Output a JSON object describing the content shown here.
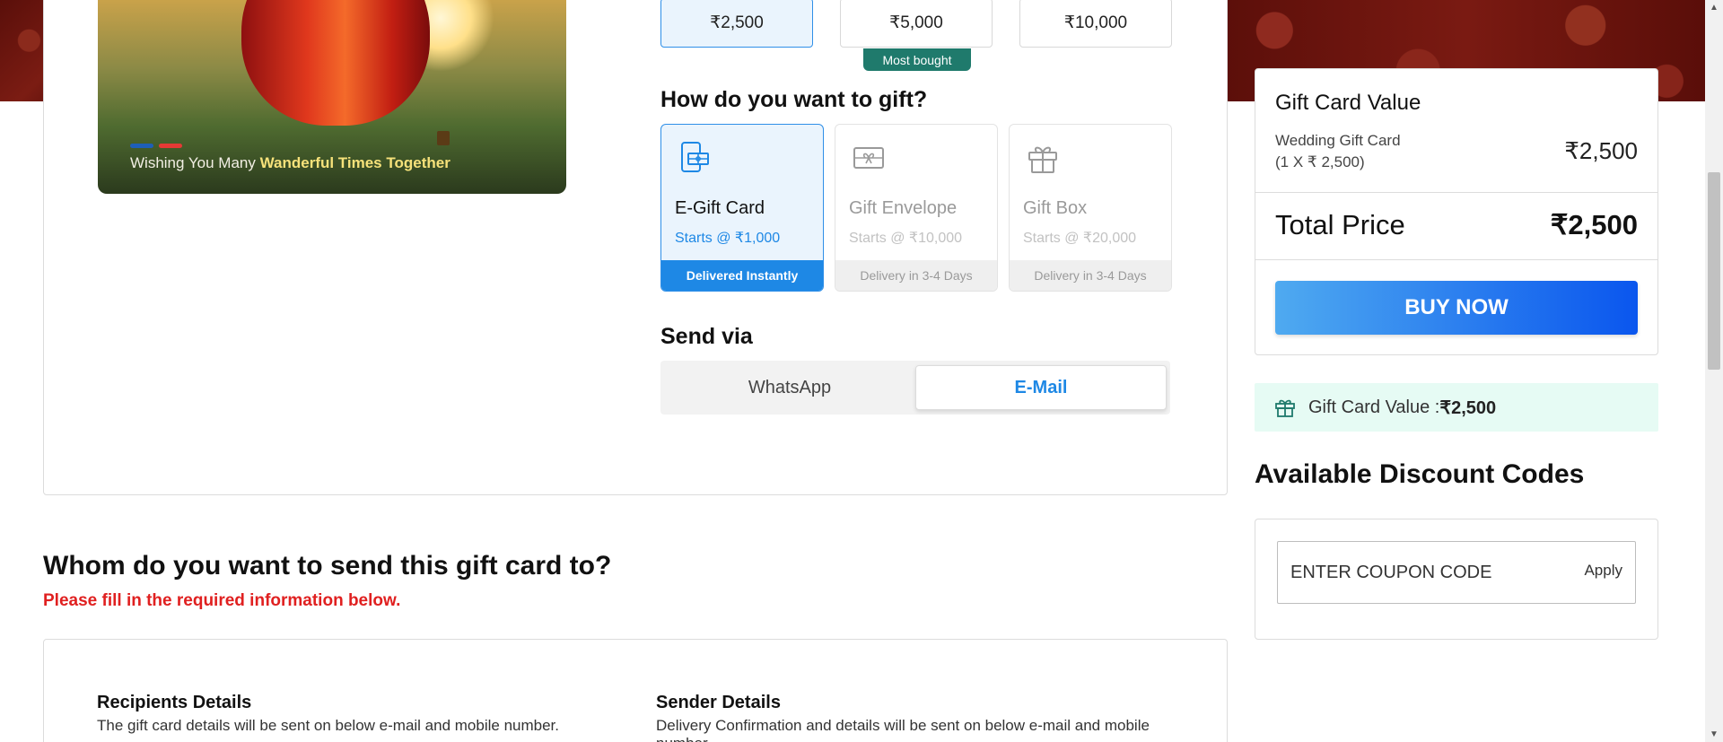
{
  "hero": {
    "caption_prefix": "Wishing You Many",
    "caption_bold": "Wanderful Times Together",
    "dot_colors": [
      "#1e5fb8",
      "#e53935"
    ]
  },
  "denominations": [
    {
      "label": "₹2,500",
      "selected": true
    },
    {
      "label": "₹5,000",
      "selected": false
    },
    {
      "label": "₹10,000",
      "selected": false
    }
  ],
  "most_bought_badge": "Most bought",
  "gift_type": {
    "title": "How do you want to gift?",
    "options": [
      {
        "name": "E-Gift Card",
        "price": "Starts @ ₹1,000",
        "footer": "Delivered Instantly",
        "icon": "phone-gift-icon",
        "active": true
      },
      {
        "name": "Gift Envelope",
        "price": "Starts @ ₹10,000",
        "footer": "Delivery in 3-4 Days",
        "icon": "envelope-gift-icon",
        "active": false
      },
      {
        "name": "Gift Box",
        "price": "Starts @ ₹20,000",
        "footer": "Delivery in 3-4 Days",
        "icon": "gift-box-icon",
        "active": false
      }
    ]
  },
  "send_via": {
    "title": "Send via",
    "options": [
      {
        "label": "WhatsApp",
        "active": false
      },
      {
        "label": "E-Mail",
        "active": true
      }
    ]
  },
  "recipient_section": {
    "title": "Whom do you want to send this gift card to?",
    "subtitle": "Please fill in the required information below.",
    "recipients_heading": "Recipients Details",
    "recipients_text": "The gift card details will be sent on below e-mail and mobile number.",
    "sender_heading": "Sender Details",
    "sender_text": "Delivery Confirmation and details will be sent on below e-mail and mobile number."
  },
  "summary": {
    "title": "Gift Card Value",
    "item_name": "Wedding Gift Card",
    "item_qty": "(1 X ₹ 2,500)",
    "item_value": "₹2,500",
    "total_label": "Total Price",
    "total_value": "₹2,500",
    "buy_label": "BUY NOW"
  },
  "gift_card_value_bar": {
    "label": "Gift Card Value : ",
    "value": "₹2,500"
  },
  "discount": {
    "title": "Available Discount Codes",
    "placeholder": "ENTER COUPON CODE",
    "apply_label": "Apply"
  },
  "colors": {
    "accent_blue": "#1e88e5",
    "badge_green": "#1f7a6c",
    "error_red": "#e02020",
    "maroon": "#6a1410"
  }
}
